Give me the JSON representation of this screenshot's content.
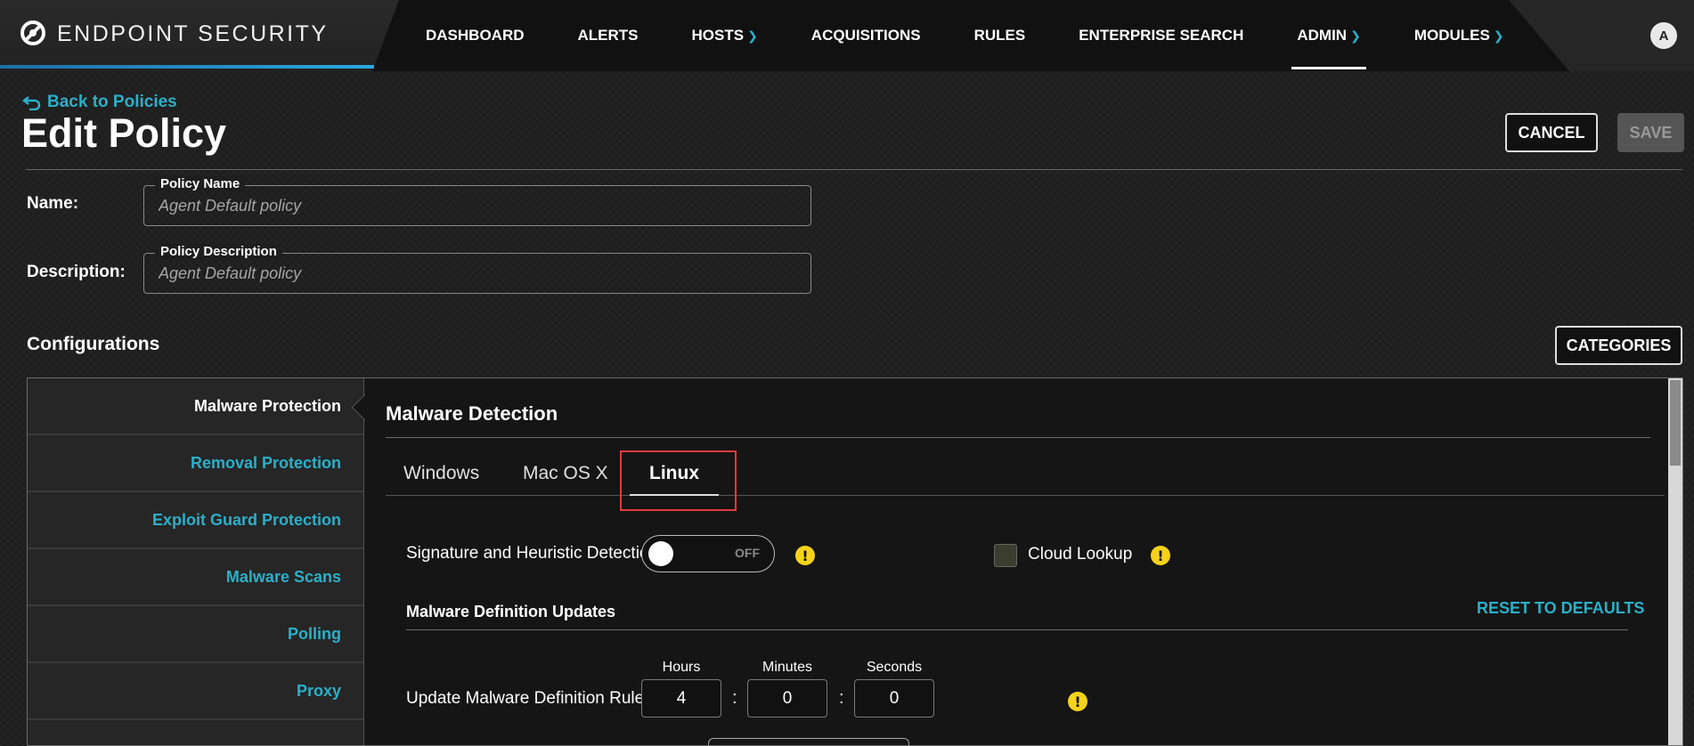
{
  "app": {
    "brand": "ENDPOINT SECURITY",
    "user_initial": "A",
    "accent_color": "#2bb0c9"
  },
  "nav": {
    "dashboard": "DASHBOARD",
    "alerts": "ALERTS",
    "hosts": "HOSTS",
    "acquisitions": "ACQUISITIONS",
    "rules": "RULES",
    "enterprise_search": "ENTERPRISE SEARCH",
    "admin": "ADMIN",
    "modules": "MODULES",
    "active": "ADMIN"
  },
  "header": {
    "back_label": "Back to Policies",
    "title": "Edit Policy",
    "cancel_label": "CANCEL",
    "save_label": "SAVE"
  },
  "form": {
    "name_label": "Name:",
    "policy_name_legend": "Policy Name",
    "policy_name_placeholder": "Agent Default policy",
    "description_label": "Description:",
    "policy_description_legend": "Policy Description",
    "policy_description_placeholder": "Agent Default policy"
  },
  "configurations": {
    "title": "Configurations",
    "categories_label": "CATEGORIES",
    "items": [
      {
        "label": "Malware Protection",
        "active": true
      },
      {
        "label": "Removal Protection",
        "active": false
      },
      {
        "label": "Exploit Guard Protection",
        "active": false
      },
      {
        "label": "Malware Scans",
        "active": false
      },
      {
        "label": "Polling",
        "active": false
      },
      {
        "label": "Proxy",
        "active": false
      }
    ]
  },
  "detail": {
    "title": "Malware Detection",
    "tabs": [
      "Windows",
      "Mac OS X",
      "Linux"
    ],
    "active_tab": "Linux",
    "signature_label": "Signature and Heuristic Detection",
    "signature_toggle": "OFF",
    "cloud_lookup_label": "Cloud Lookup",
    "cloud_lookup_checked": false,
    "updates_title": "Malware Definition Updates",
    "reset_label": "RESET TO DEFAULTS",
    "update_rules_label": "Update Malware Definition Rules:",
    "hours_label": "Hours",
    "minutes_label": "Minutes",
    "seconds_label": "Seconds",
    "hours_value": "4",
    "minutes_value": "0",
    "seconds_value": "0",
    "colon": ":"
  },
  "colors": {
    "highlight": "#e23b3b",
    "warning": "#f5d21b"
  }
}
